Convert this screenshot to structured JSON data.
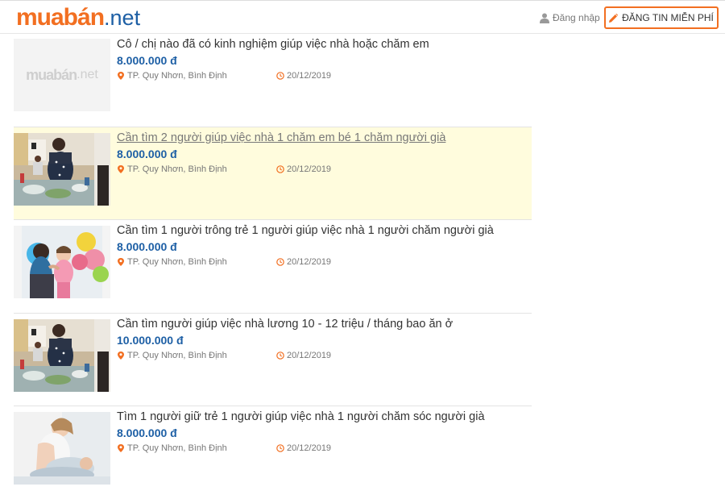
{
  "header": {
    "logo_main": "muabán",
    "logo_tld": ".net",
    "login_label": "Đăng nhập",
    "post_button_label": "ĐĂNG TIN MIỄN PHÍ"
  },
  "colors": {
    "brand_orange": "#f26f21",
    "brand_blue": "#1d5fa5",
    "highlight_bg": "#fffcdd"
  },
  "listings": [
    {
      "title": "Cô / chị nào đã có kinh nghiệm giúp việc nhà hoặc chăm em",
      "price": "8.000.000 đ",
      "location": "TP. Quy Nhơn, Bình Định",
      "date": "20/12/2019",
      "thumb": "placeholder-logo",
      "placeholder_main": "muabán",
      "placeholder_tld": ".net"
    },
    {
      "title": "Cần tìm 2 người giúp việc nhà 1 chăm em bé 1 chăm người già",
      "price": "8.000.000 đ",
      "location": "TP. Quy Nhơn, Bình Định",
      "date": "20/12/2019",
      "thumb": "kitchen-photo"
    },
    {
      "title": "Cần tìm 1 người trông trẻ 1 người giúp việc nhà 1 người chăm người già",
      "price": "8.000.000 đ",
      "location": "TP. Quy Nhơn, Bình Định",
      "date": "20/12/2019",
      "thumb": "child-balloons-photo"
    },
    {
      "title": "Cần tìm người giúp việc nhà lương 10 - 12 triệu / tháng bao ăn ở",
      "price": "10.000.000 đ",
      "location": "TP. Quy Nhơn, Bình Định",
      "date": "20/12/2019",
      "thumb": "kitchen-photo"
    },
    {
      "title": "Tìm 1 người giữ trẻ 1 người giúp việc nhà 1 người chăm sóc người già",
      "price": "8.000.000 đ",
      "location": "TP. Quy Nhơn, Bình Định",
      "date": "20/12/2019",
      "thumb": "caregiver-photo"
    }
  ],
  "icons": {
    "user": "user-icon",
    "pencil": "pencil-icon",
    "location": "map-pin-icon",
    "clock": "clock-icon"
  }
}
